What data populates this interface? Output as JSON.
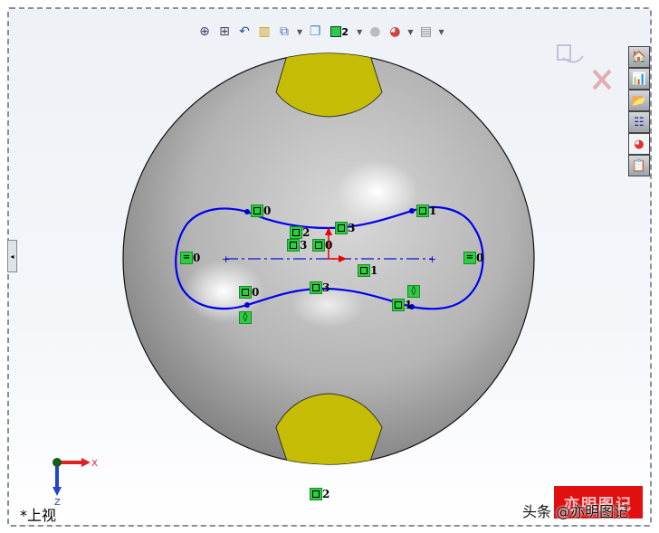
{
  "toolbar": {
    "items": [
      {
        "name": "zoom-to-fit-icon",
        "glyph": "🔍"
      },
      {
        "name": "zoom-to-area-icon",
        "glyph": "🔍"
      },
      {
        "name": "previous-view-icon",
        "glyph": "↶"
      },
      {
        "name": "section-view-icon",
        "glyph": "▥"
      },
      {
        "name": "view-orientation-icon",
        "glyph": "⬚"
      },
      {
        "name": "display-style-icon",
        "glyph": "▣"
      },
      {
        "name": "hide-show-items-icon",
        "glyph": "◻"
      },
      {
        "name": "edit-appearance-icon",
        "glyph": "●"
      },
      {
        "name": "apply-scene-icon",
        "glyph": "◕"
      },
      {
        "name": "view-settings-icon",
        "glyph": "▤"
      }
    ],
    "relation_count": "2"
  },
  "relations": {
    "top_left_coincident": "0",
    "top_right_coincident": "1",
    "top_mid": "3",
    "tangent_2": "2",
    "tangent_3": "3",
    "origin_0": "0",
    "horizontal_left": "0",
    "horizontal_right": "0",
    "center_1": "1",
    "bottom_left": "0",
    "bottom_mid": "3",
    "bottom_right": "1",
    "bottom_origin": "2"
  },
  "sidebar": {
    "items": [
      {
        "name": "resources-tab",
        "glyph": "🏠"
      },
      {
        "name": "design-library-tab",
        "glyph": "📊"
      },
      {
        "name": "file-explorer-tab",
        "glyph": "📂"
      },
      {
        "name": "view-palette-tab",
        "glyph": "☷"
      },
      {
        "name": "appearances-tab",
        "glyph": "◕"
      },
      {
        "name": "custom-properties-tab",
        "glyph": "📋"
      }
    ]
  },
  "triad": {
    "x_label": "X",
    "z_label": "Z"
  },
  "view_name": "*上视",
  "watermark": "头条 @亦明图记",
  "stamp_text": "亦明图记",
  "colors": {
    "sketch": "#0000ee",
    "relation": "#2ecc40",
    "patch": "#c8c000",
    "origin": "#ee0000"
  }
}
